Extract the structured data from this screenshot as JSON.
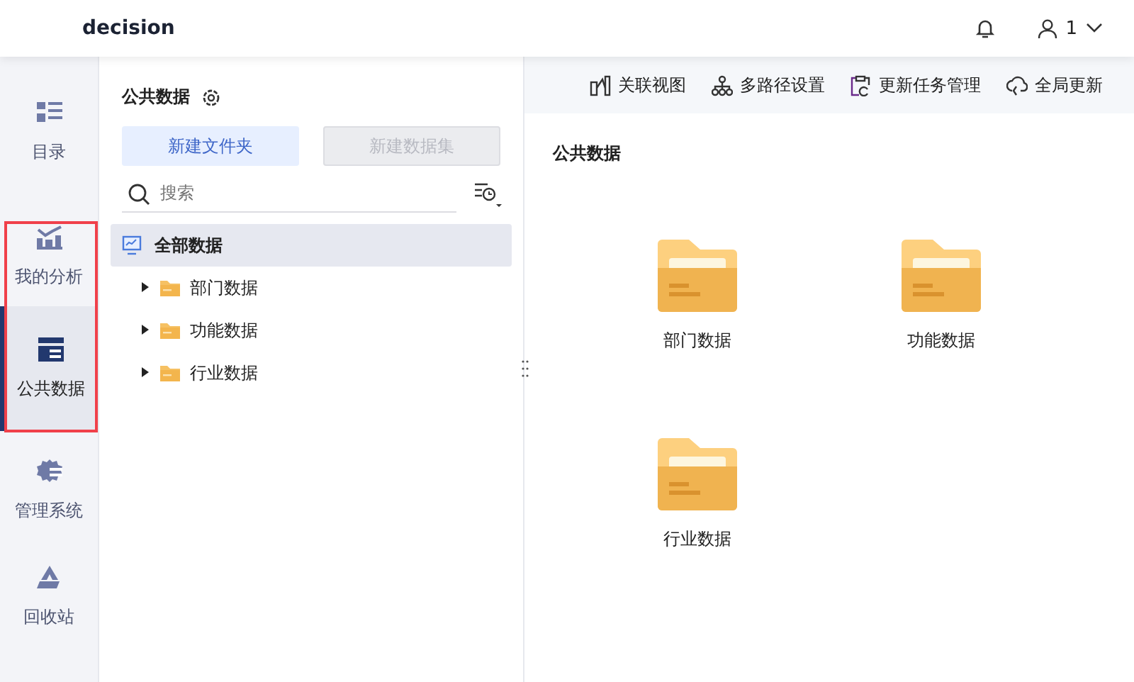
{
  "header": {
    "title": "decision",
    "user": "1"
  },
  "nav": [
    {
      "label": "目录",
      "selected": false
    },
    {
      "label": "我的分析",
      "selected": false
    },
    {
      "label": "公共数据",
      "selected": true
    },
    {
      "label": "管理系统",
      "selected": false
    },
    {
      "label": "回收站",
      "selected": false
    }
  ],
  "panel": {
    "title": "公共数据",
    "buttons": [
      {
        "label": "新建文件夹",
        "disabled": false
      },
      {
        "label": "新建数据集",
        "disabled": true
      }
    ],
    "search": {
      "placeholder": "搜索"
    },
    "tree": [
      {
        "label": "全部数据",
        "selected": true,
        "children": [
          {
            "label": "部门数据",
            "selected": false,
            "expanded": false
          },
          {
            "label": "功能数据",
            "selected": false,
            "expanded": false
          },
          {
            "label": "行业数据",
            "selected": false,
            "expanded": false
          }
        ]
      }
    ]
  },
  "toolbar": [
    {
      "label": "关联视图"
    },
    {
      "label": "多路径设置"
    },
    {
      "label": "更新任务管理"
    },
    {
      "label": "全局更新"
    }
  ],
  "content": {
    "title": "公共数据",
    "folders": [
      "部门数据",
      "功能数据",
      "行业数据"
    ]
  }
}
